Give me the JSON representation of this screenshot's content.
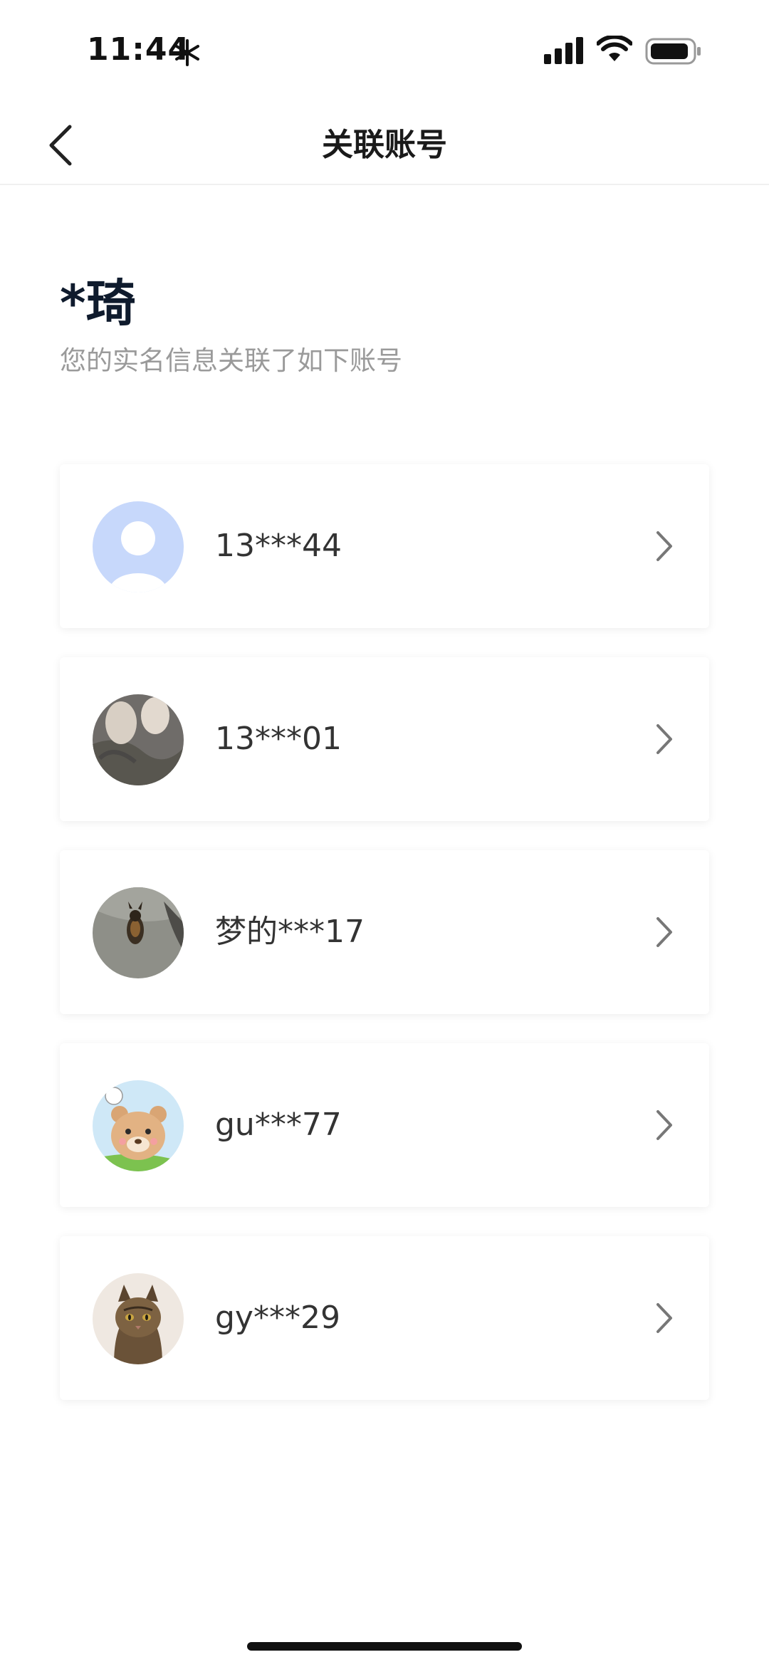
{
  "status_bar": {
    "time": "11:44"
  },
  "nav": {
    "title": "关联账号"
  },
  "header": {
    "name": "*琦",
    "subtitle": "您的实名信息关联了如下账号"
  },
  "accounts": [
    {
      "label": "13***44",
      "avatar": "default-avatar-icon"
    },
    {
      "label": "13***01",
      "avatar": "photo-avatar"
    },
    {
      "label": "梦的***17",
      "avatar": "dog-photo-avatar"
    },
    {
      "label": "gu***77",
      "avatar": "bear-cartoon-avatar"
    },
    {
      "label": "gy***29",
      "avatar": "cat-photo-avatar"
    }
  ]
}
